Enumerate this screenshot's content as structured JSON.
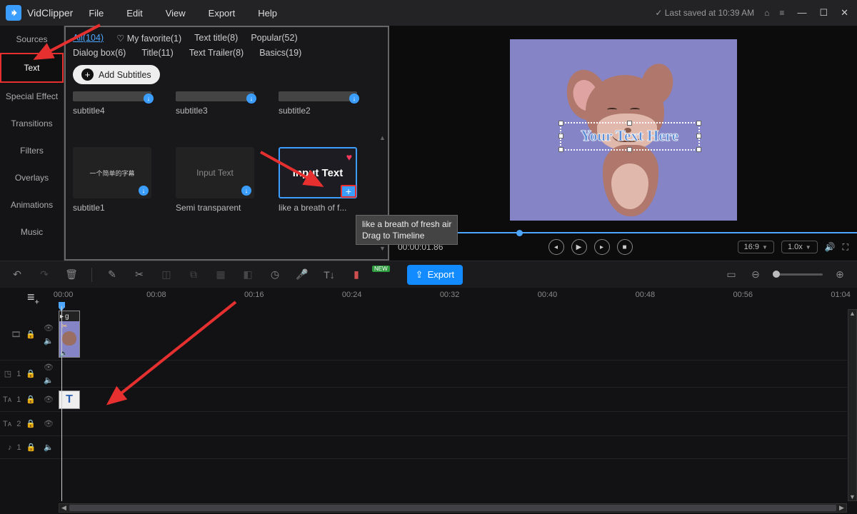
{
  "app": {
    "name": "VidClipper",
    "last_saved": "Last saved at 10:39 AM"
  },
  "menu": [
    "File",
    "Edit",
    "View",
    "Export",
    "Help"
  ],
  "sidebar": {
    "items": [
      {
        "label": "Sources"
      },
      {
        "label": "Text"
      },
      {
        "label": "Special Effect"
      },
      {
        "label": "Transitions"
      },
      {
        "label": "Filters"
      },
      {
        "label": "Overlays"
      },
      {
        "label": "Animations"
      },
      {
        "label": "Music"
      }
    ],
    "active_index": 1
  },
  "library": {
    "tabs": [
      {
        "label": "All(104)",
        "active": true
      },
      {
        "label": "My favorite(1)",
        "fav": true
      },
      {
        "label": "Text title(8)"
      },
      {
        "label": "Popular(52)"
      }
    ],
    "sub_tabs": [
      {
        "label": "Dialog box(6)"
      },
      {
        "label": "Title(11)"
      },
      {
        "label": "Text Trailer(8)"
      },
      {
        "label": "Basics(19)"
      }
    ],
    "add_btn": "Add Subtitles",
    "row1": [
      "subtitle4",
      "subtitle3",
      "subtitle2"
    ],
    "row2": {
      "c1": {
        "label": "subtitle1"
      },
      "c2": {
        "label": "Semi transparent",
        "inner": "Input Text"
      },
      "c3": {
        "label": "like a breath of f...",
        "inner": "Input Text"
      }
    }
  },
  "tooltip": {
    "line1": "like a breath of fresh air",
    "line2": "Drag to Timeline"
  },
  "preview": {
    "overlay_text": "Your Text Here",
    "timecode": "00:00:01.86",
    "aspect": "16:9",
    "speed": "1.0x"
  },
  "toolbar": {
    "export": "Export",
    "new": "NEW"
  },
  "ruler": [
    "00:00",
    "00:08",
    "00:16",
    "00:24",
    "00:32",
    "00:40",
    "00:48",
    "00:56",
    "01:04"
  ],
  "tracks": {
    "video_clip_label": "g",
    "text_clip_label": "T",
    "pip": "1",
    "txt1": "1",
    "txt2": "2",
    "aud": "1"
  }
}
